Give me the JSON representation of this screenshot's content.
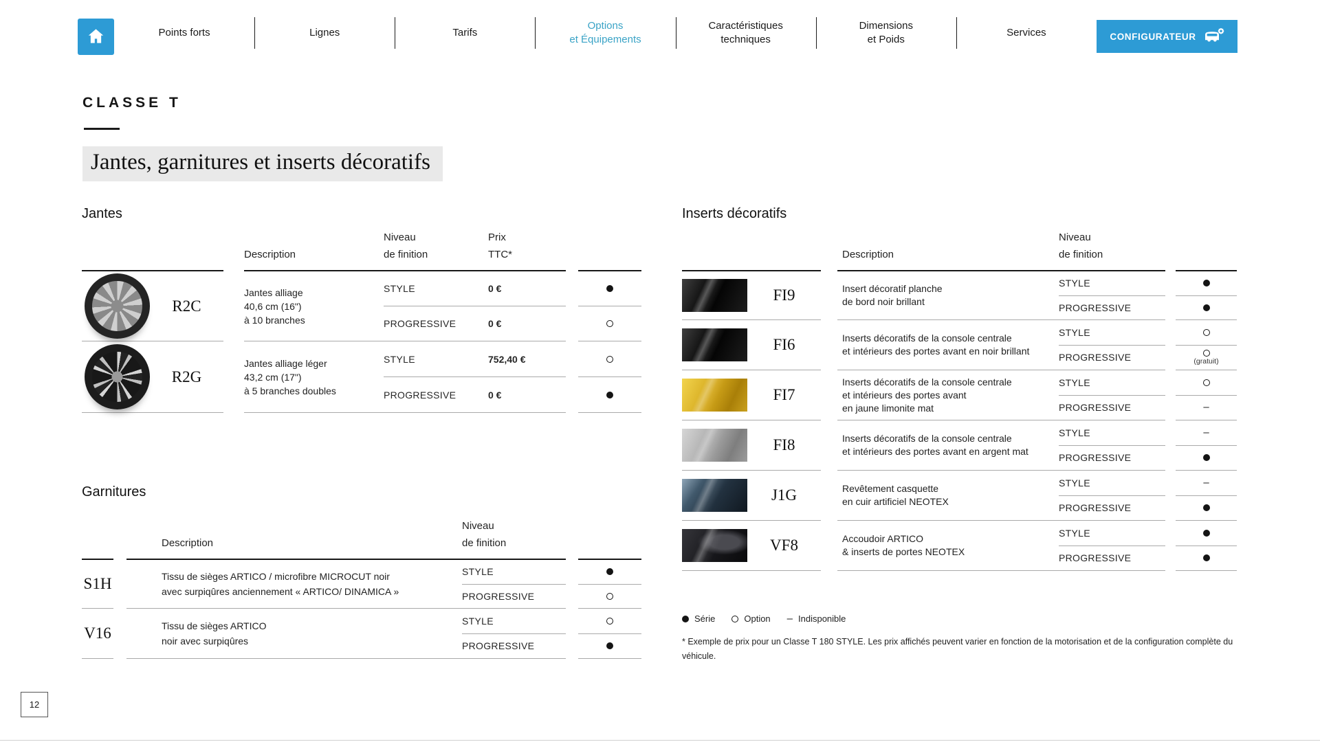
{
  "nav": {
    "items": [
      {
        "label": "Points forts",
        "active": false
      },
      {
        "label": "Lignes",
        "active": false
      },
      {
        "label": "Tarifs",
        "active": false
      },
      {
        "label": "Options\net Équipements",
        "active": true
      },
      {
        "label": "Caractéristiques\ntechniques",
        "active": false
      },
      {
        "label": "Dimensions\net Poids",
        "active": false
      },
      {
        "label": "Services",
        "active": false
      }
    ],
    "configurator_label": "CONFIGURATEUR"
  },
  "page": {
    "model": "CLASSE T",
    "title": "Jantes, garnitures et inserts décoratifs",
    "page_number": "12"
  },
  "colors": {
    "accent_blue": "#2d9bd5",
    "active_tab_teal": "#3aa3c6",
    "title_bg": "#e9e9e9"
  },
  "tables": {
    "jantes": {
      "title": "Jantes",
      "headers": {
        "description": "Description",
        "niveau": "Niveau\nde finition",
        "prix": "Prix\nTTC*"
      },
      "rows": [
        {
          "code": "R2C",
          "image": "alloy-wheel-10-spoke",
          "desc": [
            "Jantes alliage",
            "40,6 cm (16\")",
            "à 10 branches"
          ],
          "variants": [
            {
              "trim": "STYLE",
              "price": "0 €",
              "avail": "serie"
            },
            {
              "trim": "PROGRESSIVE",
              "price": "0 €",
              "avail": "option"
            }
          ]
        },
        {
          "code": "R2G",
          "image": "alloy-wheel-5-double-spoke",
          "desc": [
            "Jantes alliage léger",
            "43,2 cm (17\")",
            "à 5 branches doubles"
          ],
          "variants": [
            {
              "trim": "STYLE",
              "price": "752,40 €",
              "avail": "option"
            },
            {
              "trim": "PROGRESSIVE",
              "price": "0 €",
              "avail": "serie"
            }
          ]
        }
      ]
    },
    "garnitures": {
      "title": "Garnitures",
      "headers": {
        "description": "Description",
        "niveau": "Niveau\nde finition"
      },
      "rows": [
        {
          "code": "S1H",
          "desc": [
            "Tissu de sièges ARTICO / microfibre MICROCUT noir",
            "avec surpiqûres anciennement « ARTICO/ DINAMICA »"
          ],
          "variants": [
            {
              "trim": "STYLE",
              "avail": "serie"
            },
            {
              "trim": "PROGRESSIVE",
              "avail": "option"
            }
          ]
        },
        {
          "code": "V16",
          "desc": [
            "Tissu de sièges ARTICO",
            "noir avec surpiqûres"
          ],
          "variants": [
            {
              "trim": "STYLE",
              "avail": "option"
            },
            {
              "trim": "PROGRESSIVE",
              "avail": "serie"
            }
          ]
        }
      ]
    },
    "inserts": {
      "title": "Inserts décoratifs",
      "headers": {
        "description": "Description",
        "niveau": "Niveau\nde finition"
      },
      "rows": [
        {
          "code": "FI9",
          "swatch": "noir-brillant",
          "desc": [
            "Insert décoratif planche",
            "de bord noir brillant"
          ],
          "variants": [
            {
              "trim": "STYLE",
              "avail": "serie"
            },
            {
              "trim": "PROGRESSIVE",
              "avail": "serie"
            }
          ]
        },
        {
          "code": "FI6",
          "swatch": "noir-brillant",
          "desc": [
            "Inserts décoratifs de la console centrale",
            "et intérieurs des portes avant en noir brillant"
          ],
          "variants": [
            {
              "trim": "STYLE",
              "avail": "option"
            },
            {
              "trim": "PROGRESSIVE",
              "avail": "option",
              "note": "(gratuit)"
            }
          ]
        },
        {
          "code": "FI7",
          "swatch": "jaune-limonite",
          "desc": [
            "Inserts décoratifs de la console centrale",
            "et intérieurs des portes avant",
            "en jaune limonite mat"
          ],
          "variants": [
            {
              "trim": "STYLE",
              "avail": "option"
            },
            {
              "trim": "PROGRESSIVE",
              "avail": "indisponible"
            }
          ]
        },
        {
          "code": "FI8",
          "swatch": "argent-mat",
          "desc": [
            "Inserts décoratifs de la console centrale",
            "et intérieurs des portes avant en argent mat"
          ],
          "variants": [
            {
              "trim": "STYLE",
              "avail": "indisponible"
            },
            {
              "trim": "PROGRESSIVE",
              "avail": "serie"
            }
          ]
        },
        {
          "code": "J1G",
          "swatch": "cuir-neotex",
          "desc": [
            "Revêtement casquette",
            "en cuir artificiel NEOTEX"
          ],
          "variants": [
            {
              "trim": "STYLE",
              "avail": "indisponible"
            },
            {
              "trim": "PROGRESSIVE",
              "avail": "serie"
            }
          ]
        },
        {
          "code": "VF8",
          "swatch": "artico-neotex",
          "desc": [
            "Accoudoir ARTICO",
            "& inserts de portes NEOTEX"
          ],
          "variants": [
            {
              "trim": "STYLE",
              "avail": "serie"
            },
            {
              "trim": "PROGRESSIVE",
              "avail": "serie"
            }
          ]
        }
      ]
    }
  },
  "legend": {
    "serie": "Série",
    "option": "Option",
    "indisponible": "Indisponible"
  },
  "footnote": "* Exemple de prix pour un Classe T 180 STYLE. Les prix affichés peuvent varier en fonction de la motorisation et de la configuration complète du véhicule."
}
